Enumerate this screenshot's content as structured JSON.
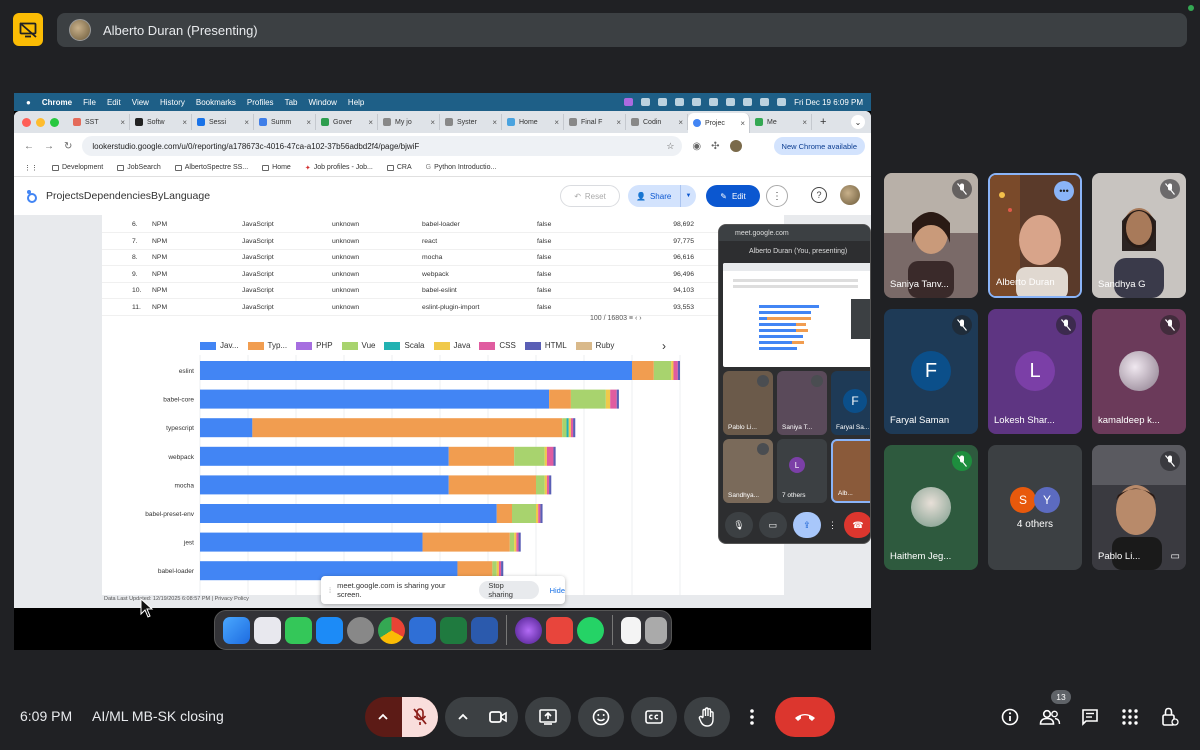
{
  "meet": {
    "presenter_label": "Alberto Duran (Presenting)",
    "clock": "6:09 PM",
    "meeting_name": "AI/ML MB-SK closing",
    "people_count": "13",
    "participants": [
      {
        "name": "Saniya Tanv..."
      },
      {
        "name": "Alberto Duran"
      },
      {
        "name": "Sandhya G"
      },
      {
        "name": "Faryal Saman",
        "initial": "F",
        "color": "#0b4f8a"
      },
      {
        "name": "Lokesh Shar...",
        "initial": "L",
        "color": "#7b3fa7"
      },
      {
        "name": "kamaldeep k..."
      },
      {
        "name": "Haithem Jeg..."
      },
      {
        "others_label": "4 others",
        "initials": [
          "S",
          "Y"
        ],
        "colors": [
          "#e8590c",
          "#5c6bc0"
        ]
      },
      {
        "name": "Pablo Li..."
      }
    ]
  },
  "mac": {
    "menu": [
      "Chrome",
      "File",
      "Edit",
      "View",
      "History",
      "Bookmarks",
      "Profiles",
      "Tab",
      "Window",
      "Help"
    ],
    "datetime": "Fri Dec 19  6:09 PM"
  },
  "browser": {
    "tabs": [
      "SST",
      "Softw",
      "Sessi",
      "Summ",
      "Gover",
      "My jo",
      "Syster",
      "Home",
      "Final F",
      "Codin",
      "Projec",
      "Me"
    ],
    "url": "lookerstudio.google.com/u/0/reporting/a178673c-4016-47ca-a102-37b56adbd2f4/page/bjwiF",
    "new_chrome": "New Chrome available",
    "bookmarks": [
      "Development",
      "JobSearch",
      "AlbertoSpectre SS...",
      "Home",
      "Job profiles - Job...",
      "CRA",
      "Python Introductio..."
    ]
  },
  "report": {
    "title": "ProjectsDependenciesByLanguage",
    "reset": "Reset",
    "share": "Share",
    "edit": "Edit",
    "pager": "100 / 16803",
    "footer": "Data Last Updated: 12/19/2025 6:08:57 PM  |  Privacy Policy",
    "rows": [
      [
        "6.",
        "NPM",
        "JavaScript",
        "unknown",
        "babel-loader",
        "false",
        "98,692"
      ],
      [
        "7.",
        "NPM",
        "JavaScript",
        "unknown",
        "react",
        "false",
        "97,775"
      ],
      [
        "8.",
        "NPM",
        "JavaScript",
        "unknown",
        "mocha",
        "false",
        "96,616"
      ],
      [
        "9.",
        "NPM",
        "JavaScript",
        "unknown",
        "webpack",
        "false",
        "96,496"
      ],
      [
        "10.",
        "NPM",
        "JavaScript",
        "unknown",
        "babel-eslint",
        "false",
        "94,103"
      ],
      [
        "11.",
        "NPM",
        "JavaScript",
        "unknown",
        "eslint-plugin-import",
        "false",
        "93,553"
      ]
    ]
  },
  "chart_data": {
    "type": "bar",
    "orientation": "horizontal",
    "stacked": true,
    "categories": [
      "eslint",
      "babel-core",
      "typescript",
      "webpack",
      "mocha",
      "babel-preset-env",
      "jest",
      "babel-loader"
    ],
    "series": [
      {
        "name": "Jav...",
        "color": "#4285f4",
        "values": [
          99000,
          80000,
          12000,
          57000,
          57000,
          68000,
          51000,
          59000
        ]
      },
      {
        "name": "Typ...",
        "color": "#f19d50",
        "values": [
          5000,
          5000,
          71000,
          15000,
          20000,
          3500,
          20000,
          8000
        ]
      },
      {
        "name": "PHP",
        "color": "#a66ee0",
        "values": [
          0,
          0,
          0,
          0,
          0,
          0,
          0,
          0
        ]
      },
      {
        "name": "Vue",
        "color": "#a8d36e",
        "values": [
          4000,
          8000,
          1000,
          7000,
          2000,
          5500,
          1000,
          1000
        ]
      },
      {
        "name": "Scala",
        "color": "#22b2b2",
        "values": [
          0,
          0,
          500,
          0,
          0,
          0,
          0,
          0
        ]
      },
      {
        "name": "Java",
        "color": "#f0c94a",
        "values": [
          500,
          1000,
          500,
          500,
          500,
          500,
          500,
          500
        ]
      },
      {
        "name": "CSS",
        "color": "#e05ca0",
        "values": [
          1000,
          1500,
          500,
          1500,
          500,
          500,
          500,
          500
        ]
      },
      {
        "name": "HTML",
        "color": "#5a5fb5",
        "values": [
          500,
          500,
          500,
          500,
          500,
          500,
          500,
          500
        ]
      },
      {
        "name": "Ruby",
        "color": "#d9b98a",
        "values": [
          0,
          0,
          0,
          0,
          0,
          0,
          0,
          0
        ]
      }
    ],
    "xlim": [
      0,
      110000
    ],
    "grid": true,
    "legend": "top"
  },
  "pip": {
    "url": "meet.google.com",
    "title": "Alberto Duran (You, presenting)",
    "tiles": [
      "Pablo Li...",
      "Saniya T...",
      "Faryal Sa...",
      "Sandhya...",
      "7 others",
      "Alb..."
    ],
    "faryal_initial": "F",
    "others_initial": "L"
  },
  "share_banner": {
    "text": "meet.google.com is sharing your screen.",
    "stop": "Stop sharing",
    "hide": "Hide"
  },
  "colors": {
    "meet_bg": "#202124",
    "tile_bg": "#3c4043",
    "leave_red": "#dc362e",
    "accent_blue": "#0b57d0"
  }
}
